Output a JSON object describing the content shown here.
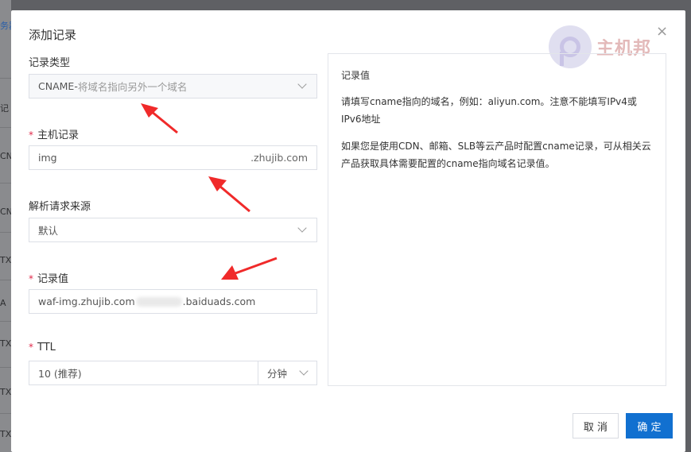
{
  "background": {
    "left_fragments": [
      "务器",
      "记",
      "CN",
      "CN",
      "TX",
      "A",
      "TX",
      "TX",
      "TX"
    ]
  },
  "dialog": {
    "title": "添加记录",
    "close_glyph": "×",
    "watermark_text": "主机邦"
  },
  "form": {
    "record_type": {
      "label": "记录类型",
      "value": "CNAME-",
      "hint": " 将域名指向另外一个域名"
    },
    "host_record": {
      "required_mark": "*",
      "label": "主机记录",
      "value": "img",
      "suffix": ".zhujib.com"
    },
    "resolve_source": {
      "label": "解析请求来源",
      "value": "默认"
    },
    "record_value": {
      "required_mark": "*",
      "label": "记录值",
      "value_prefix": "waf-img.zhujib.com",
      "value_suffix": ".baiduads.com"
    },
    "ttl": {
      "required_mark": "*",
      "label": "TTL",
      "value": "10 (推荐)",
      "unit": "分钟"
    }
  },
  "info_panel": {
    "heading": "记录值",
    "para1": "请填写cname指向的域名，例如：aliyun.com。注意不能填写IPv4或IPv6地址",
    "para2": "如果您是使用CDN、邮箱、SLB等云产品时配置cname记录，可从相关云产品获取具体需要配置的cname指向域名记录值。"
  },
  "footer": {
    "cancel_label": "取 消",
    "confirm_label": "确 定"
  },
  "colors": {
    "primary": "#1170d0",
    "required": "#e0294a",
    "annotation_arrow": "#f02a2a"
  }
}
